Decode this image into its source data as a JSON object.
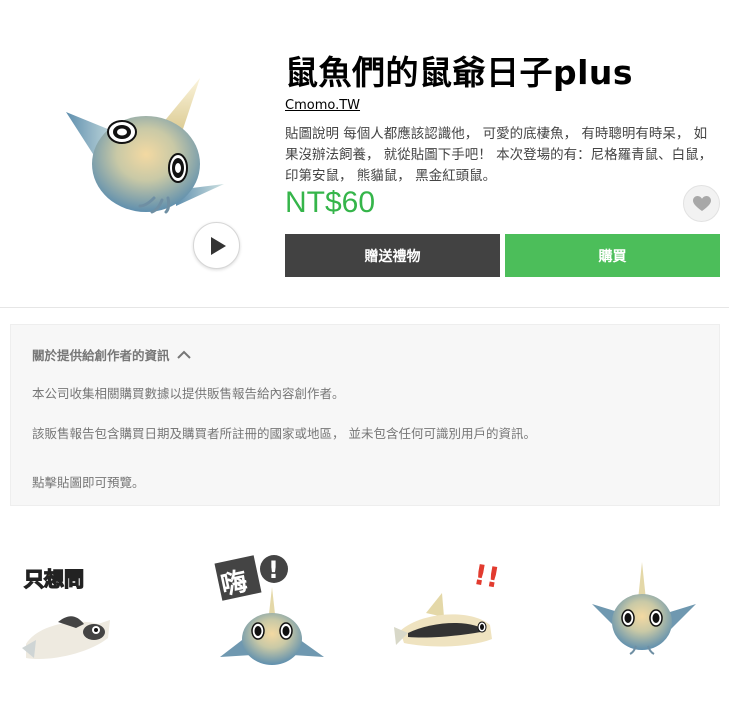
{
  "product": {
    "title": "鼠魚們的鼠爺日子plus",
    "author": "Cmomo.TW",
    "description": "貼圖說明 每個人都應該認識他， 可愛的底棲魚， 有時聰明有時呆， 如果沒辦法飼養， 就從貼圖下手吧！ 本次登場的有：尼格羅青鼠、白鼠， 印第安鼠， 熊貓鼠， 黑金紅頭鼠。",
    "price": "NT$60",
    "gift_label": "贈送禮物",
    "buy_label": "購買"
  },
  "info": {
    "header": "關於提供給創作者的資訊",
    "line1": "本公司收集相關購買數據以提供販售報告給內容創作者。",
    "line2": "該販售報告包含購買日期及購買者所註冊的國家或地區， 並未包含任何可識別用戶的資訊。",
    "line3": "點擊貼圖即可預覽。"
  },
  "stickers": {
    "s1_text": "只想問",
    "s2_text": "嗨",
    "s2_mark": "!",
    "s3_mark": "!!"
  },
  "colors": {
    "price_green": "#35b54a",
    "buy_green": "#4cbe5a",
    "gift_dark": "#424242"
  }
}
